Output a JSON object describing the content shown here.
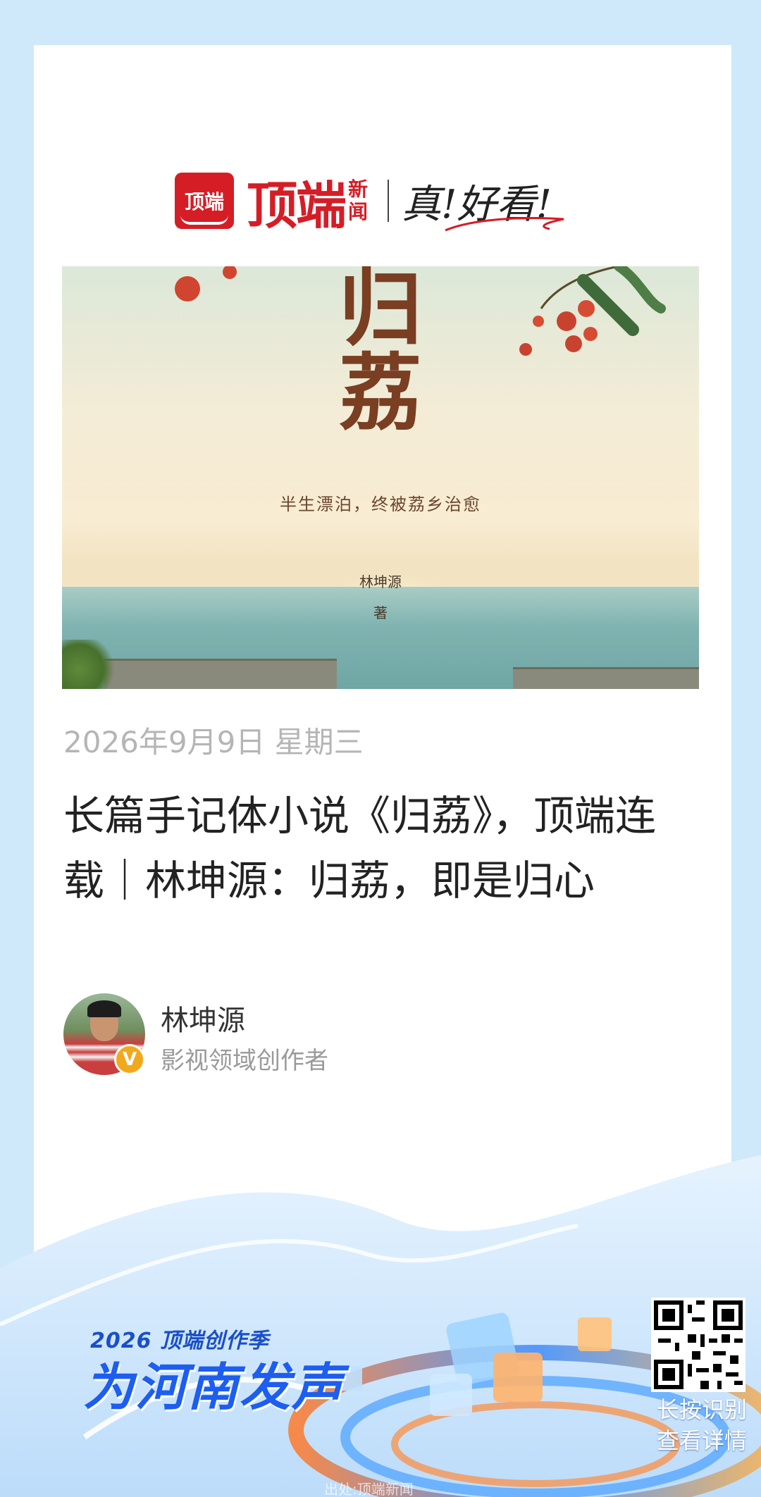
{
  "brand": {
    "logo_text": "顶端",
    "name": "顶端",
    "news_label": "新闻",
    "slogan": "真!好看!"
  },
  "cover": {
    "title": "归荔",
    "subtitle": "半生漂泊，终被荔乡治愈",
    "author": "林坤源",
    "author_suffix": "著"
  },
  "article": {
    "date": "2026年9月9日 星期三",
    "headline": "长篇手记体小说《归荔》，顶端连载｜林坤源：归荔，即是归心"
  },
  "author": {
    "name": "林坤源",
    "role": "影视领域创作者",
    "badge": "V"
  },
  "banner": {
    "campaign_year": "2026 顶端创作季",
    "campaign_slogan": "为河南发声",
    "qr_hint_line1": "长按识别",
    "qr_hint_line2": "查看详情",
    "watermark": "出处:顶端新闻"
  },
  "colors": {
    "brand_red": "#d51d26",
    "page_bg": "#cfe9fb",
    "campaign_blue": "#1d5ef0",
    "verify_gold": "#f2a81d"
  }
}
